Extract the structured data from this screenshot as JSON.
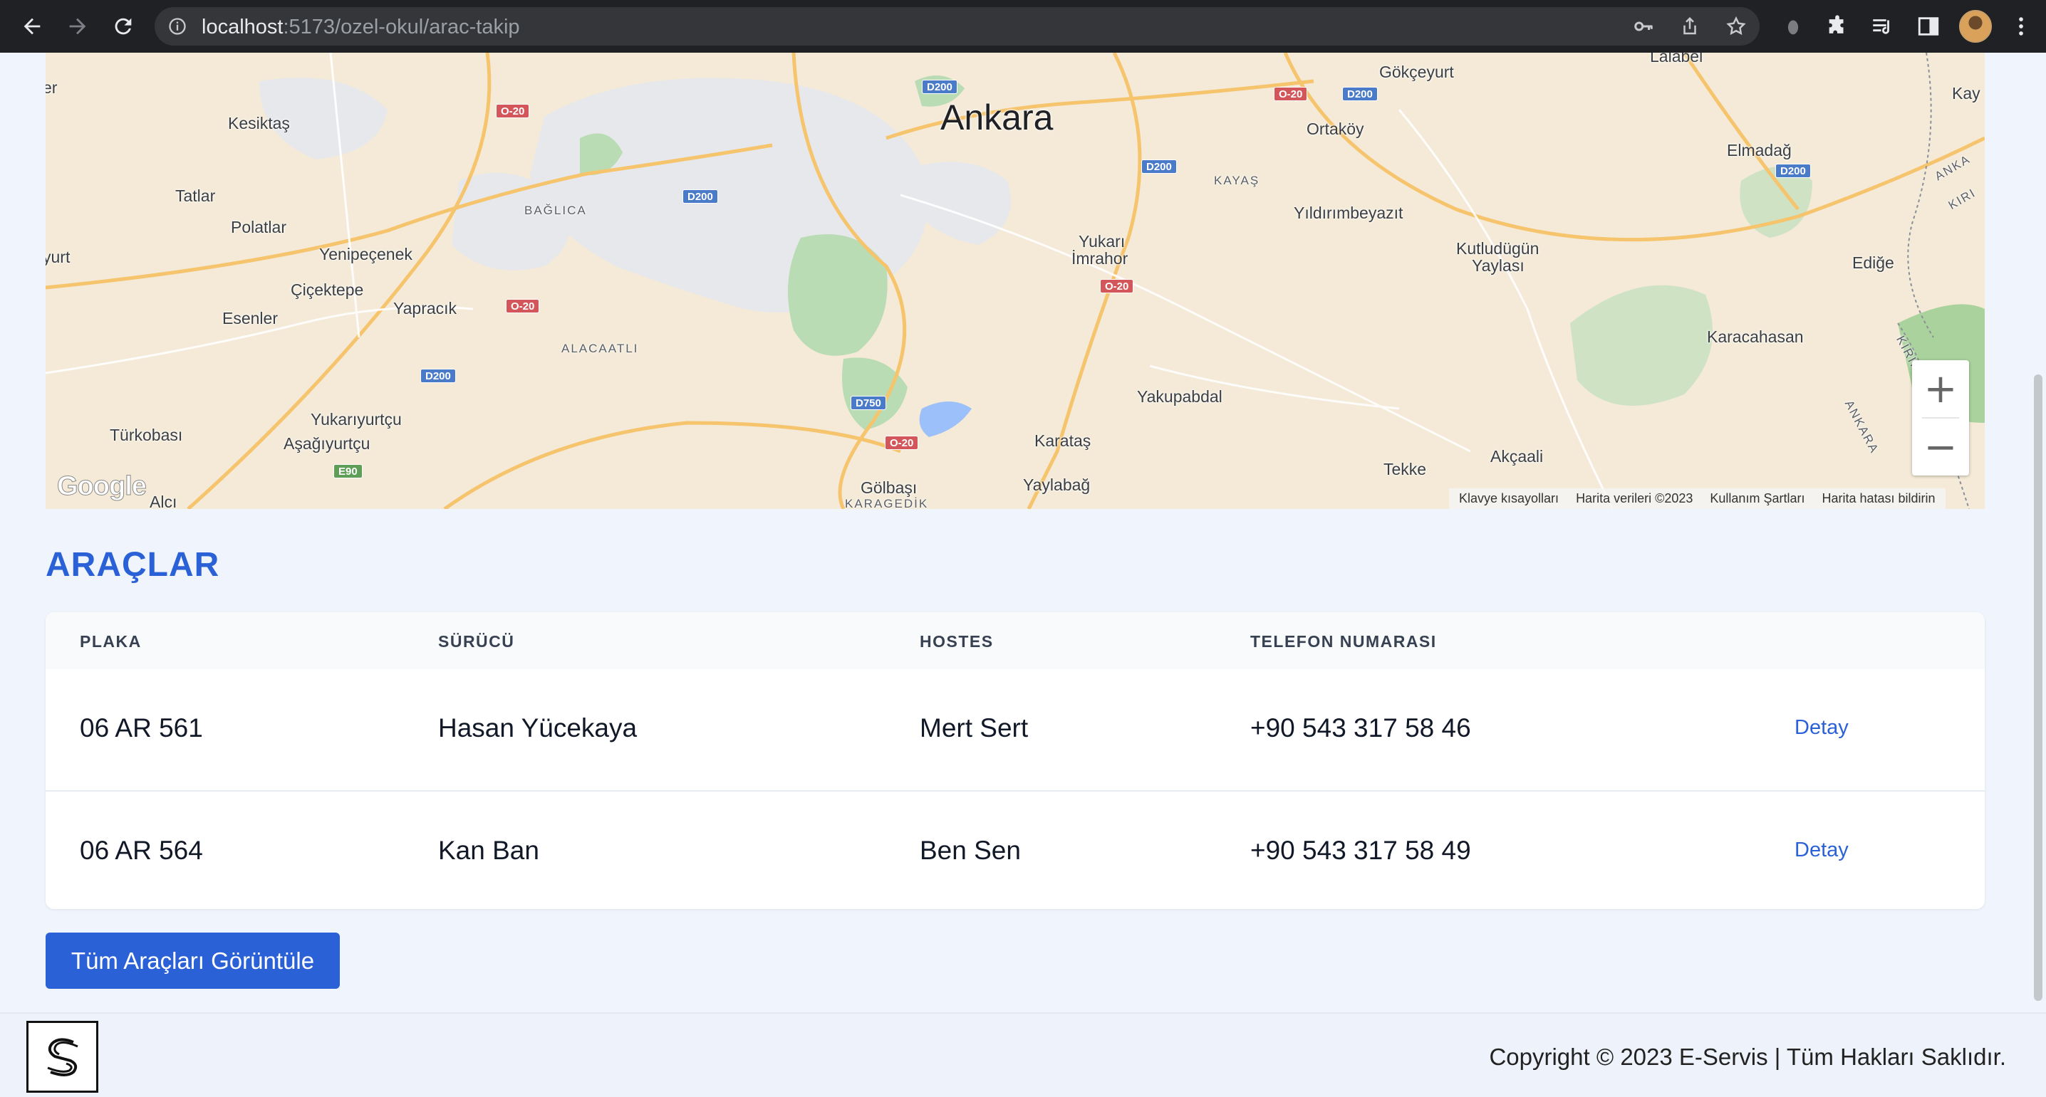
{
  "browser": {
    "url_host": "localhost",
    "url_path": ":5173/ozel-okul/arac-takip"
  },
  "map": {
    "city_label": "Ankara",
    "places": [
      {
        "name": "Kesiktaş"
      },
      {
        "name": "Tatlar"
      },
      {
        "name": "Polatlar"
      },
      {
        "name": "Yenipeçenek"
      },
      {
        "name": "Çiçektepe"
      },
      {
        "name": "Esenler"
      },
      {
        "name": "Yapracık"
      },
      {
        "name": "Türkobası"
      },
      {
        "name": "Yukarıyurtçu"
      },
      {
        "name": "Aşağıyurtçu"
      },
      {
        "name": "Alcı"
      },
      {
        "name": "Gökçeyurt"
      },
      {
        "name": "Ortaköy"
      },
      {
        "name": "Yıldırımbeyazıt"
      },
      {
        "name": "Yukarı"
      },
      {
        "name": "İmrahor"
      },
      {
        "name": "Kutludügün"
      },
      {
        "name": "Yaylası"
      },
      {
        "name": "Elmadağ"
      },
      {
        "name": "Ediğe"
      },
      {
        "name": "Karacahasan"
      },
      {
        "name": "Yakupabdal"
      },
      {
        "name": "Karataş"
      },
      {
        "name": "Yaylabağ"
      },
      {
        "name": "Gölbaşı"
      },
      {
        "name": "Tekke"
      },
      {
        "name": "Akçaali"
      },
      {
        "name": "Lalabel"
      },
      {
        "name": "Kay"
      },
      {
        "name": "er"
      },
      {
        "name": "yurt"
      }
    ],
    "districts": [
      "BAĞLICA",
      "ALACAATLI",
      "KAYAŞ",
      "KARAGEDİK"
    ],
    "region_labels": [
      "ANKA",
      "KIRI",
      "KIRIKKALE",
      "ANKARA"
    ],
    "shields": [
      "O-20",
      "D200",
      "D750",
      "E90"
    ],
    "google_logo": "Google",
    "attribution": [
      "Klavye kısayolları",
      "Harita verileri ©2023",
      "Kullanım Şartları",
      "Harita hatası bildirin"
    ],
    "zoom_in": "+",
    "zoom_out": "−"
  },
  "section": {
    "title": "ARAÇLAR"
  },
  "table": {
    "headers": [
      "PLAKA",
      "SÜRÜCÜ",
      "HOSTES",
      "TELEFON NUMARASI"
    ],
    "rows": [
      {
        "plate": "06 AR 561",
        "driver": "Hasan Yücekaya",
        "hostess": "Mert Sert",
        "phone": "+90 543 317 58 46",
        "action": "Detay"
      },
      {
        "plate": "06 AR 564",
        "driver": "Kan Ban",
        "hostess": "Ben Sen",
        "phone": "+90 543 317 58 49",
        "action": "Detay"
      }
    ]
  },
  "actions": {
    "view_all": "Tüm Araçları Görüntüle"
  },
  "footer": {
    "copyright": "Copyright © 2023 E-Servis | Tüm Hakları Saklıdır."
  },
  "colors": {
    "accent": "#2b61d6",
    "page_bg": "#f0f5fd"
  }
}
